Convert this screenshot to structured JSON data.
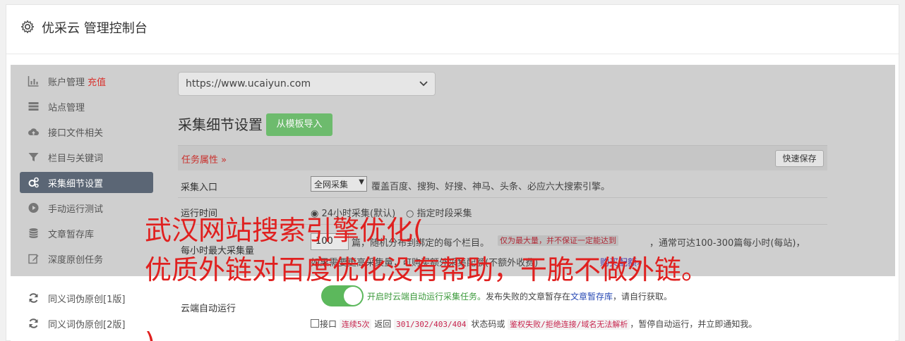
{
  "header": {
    "title": "优采云 管理控制台",
    "icon": "gear-icon"
  },
  "sidebar": {
    "items": [
      {
        "label": "账户管理",
        "badge": "充值",
        "icon": "bar-chart-icon"
      },
      {
        "label": "站点管理",
        "icon": "server-icon"
      },
      {
        "label": "接口文件相关",
        "icon": "cloud-upload-icon"
      },
      {
        "label": "栏目与关键词",
        "icon": "filter-icon"
      },
      {
        "label": "采集细节设置",
        "icon": "cogs-icon",
        "active": true
      },
      {
        "label": "手动运行测试",
        "icon": "play-circle-icon"
      },
      {
        "label": "文章暂存库",
        "icon": "database-icon"
      },
      {
        "label": "深度原创任务",
        "icon": "edit-icon"
      },
      {
        "label": "同义词伪原创[1版]",
        "icon": "refresh-icon"
      },
      {
        "label": "同义词伪原创[2版]",
        "icon": "refresh-icon"
      }
    ]
  },
  "main": {
    "site_select": "https://www.ucaiyun.com",
    "section_title": "采集细节设置",
    "import_button": "从模板导入",
    "task_attr": "任务属性 »",
    "quick_save": "快速保存",
    "entry": {
      "label": "采集入口",
      "select": "全网采集",
      "desc": "覆盖百度、搜狗、好搜、神马、头条、必应六大搜索引擎。"
    },
    "runtime": {
      "label": "运行时间",
      "opt1": "24小时采集(默认)",
      "opt2": "指定时段采集"
    },
    "max": {
      "label": "每小时最大采集量",
      "value": "100",
      "desc1": "篇，随机分布到绑定的每个栏目。",
      "badge": "仅为最大量，并不保证一定能达到",
      "desc2": "，通常可达100-300篇每小时(每站)，",
      "desc3": "如果需要更高采集量，可购买额外采集配额(不额外收费)",
      "link": "购买配额»"
    },
    "cloud": {
      "label": "云端自动运行",
      "on_text": "开启时云端自动运行采集任务。",
      "fail_text": "发布失败的文章暂存在",
      "link": "文章暂存库",
      "fail_end": "，请自行获取。",
      "check_prefix": "接口",
      "code1": "连续5次",
      "mid1": "返回",
      "code2": "301/302/403/404",
      "mid2": "状态码或",
      "code3": "鉴权失败/拒绝连接/域名无法解析",
      "end": "，暂停自动运行，并立即通知我。"
    }
  },
  "overlay": {
    "line1": "武汉网站搜索引擎优化(",
    "line2": "优质外链对百度优化没有帮助，干脆不做外链。",
    "line3": ")",
    "color": "#e0201f"
  }
}
